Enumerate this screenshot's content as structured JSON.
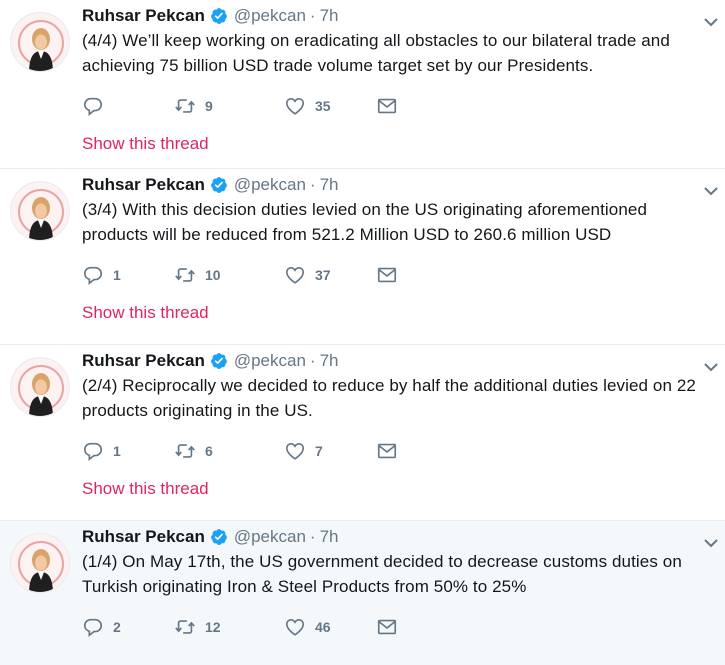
{
  "author": {
    "name": "Ruhsar Pekcan",
    "handle": "@pekcan",
    "time": "7h"
  },
  "show_thread_label": "Show this thread",
  "colors": {
    "text": "#14171a",
    "muted": "#657786",
    "thread_link": "#e0245e",
    "verified": "#1da1f2",
    "highlight_bg": "#f5f8fa"
  },
  "icons": [
    "reply-icon",
    "retweet-icon",
    "like-icon",
    "dm-icon",
    "verified-badge-icon",
    "chevron-down-icon"
  ],
  "tweets": [
    {
      "text": "(4/4) We’ll keep working on eradicating all obstacles to our bilateral trade and achieving 75 billion USD trade volume target set by our Presidents.",
      "replies": "",
      "retweets": "9",
      "likes": "35",
      "show_thread": true
    },
    {
      "text": "(3/4)  With this decision duties levied on the US originating aforementioned products will be reduced from 521.2 Million USD to 260.6 million USD",
      "replies": "1",
      "retweets": "10",
      "likes": "37",
      "show_thread": true
    },
    {
      "text": "(2/4) Reciprocally we decided to reduce by half the additional duties levied on 22 products originating in the US.",
      "replies": "1",
      "retweets": "6",
      "likes": "7",
      "show_thread": true
    },
    {
      "text": "(1/4) On May 17th, the US government decided to decrease customs duties on Turkish originating Iron & Steel Products from 50% to 25%",
      "replies": "2",
      "retweets": "12",
      "likes": "46",
      "show_thread": false
    }
  ]
}
